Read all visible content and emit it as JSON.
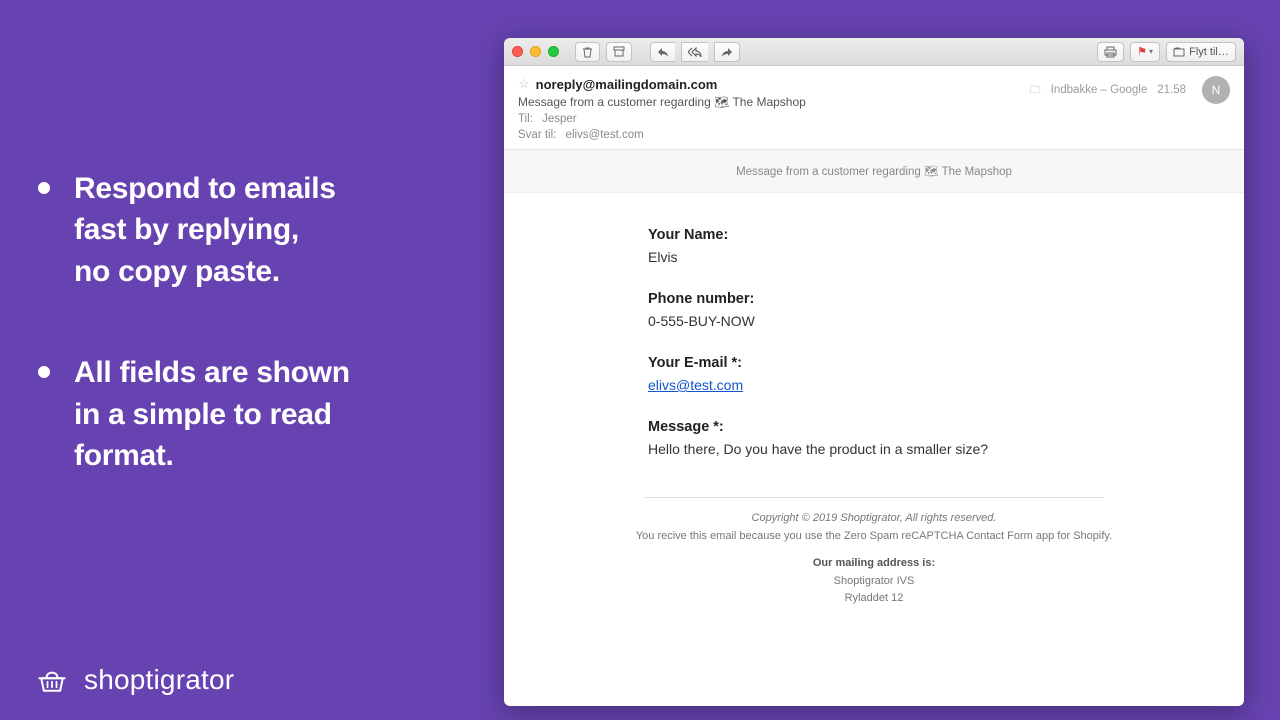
{
  "marketing": {
    "bullet1_l1": "Respond to emails",
    "bullet1_l2": "fast by replying,",
    "bullet1_l3": "no copy paste.",
    "bullet2_l1": "All fields are shown",
    "bullet2_l2": "in a simple to read",
    "bullet2_l3": "format."
  },
  "brand": {
    "name": "shoptigrator"
  },
  "toolbar": {
    "move_label": "Flyt til…"
  },
  "header": {
    "from": "noreply@mailingdomain.com",
    "subject_prefix": "Message from a customer regarding ",
    "subject_shop": "The Mapshop",
    "to_label": "Til:",
    "to_value": "Jesper",
    "replyto_label": "Svar til:",
    "replyto_value": "elivs@test.com",
    "folder": "Indbakke – Google",
    "time": "21.58",
    "avatar_letter": "N"
  },
  "body": {
    "bar_prefix": "Message from a customer regarding ",
    "bar_shop": "The Mapshop",
    "fields": {
      "name_label": "Your Name:",
      "name_value": "Elvis",
      "phone_label": "Phone number:",
      "phone_value": "0-555-BUY-NOW",
      "email_label": "Your E-mail *:",
      "email_value": "elivs@test.com",
      "message_label": "Message *:",
      "message_value": "Hello there, Do you have the product in a smaller size?"
    }
  },
  "footer": {
    "copyright": "Copyright © 2019 Shoptigrator, All rights reserved.",
    "reason": "You recive this email because you use the Zero Spam reCAPTCHA Contact Form app for Shopify.",
    "addr_heading": "Our mailing address is:",
    "addr_line1": "Shoptigrator IVS",
    "addr_line2": "Ryladdet 12"
  }
}
